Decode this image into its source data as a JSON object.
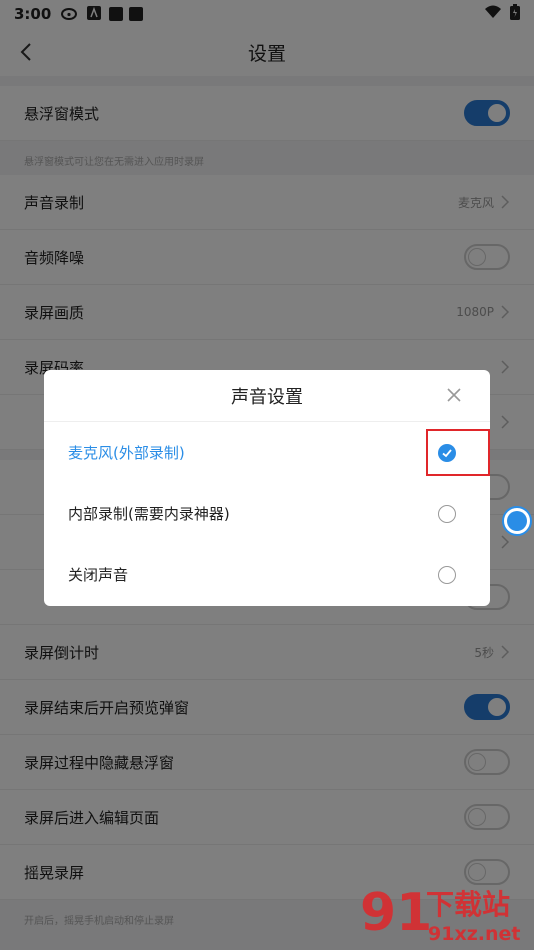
{
  "statusbar": {
    "time": "3:00"
  },
  "header": {
    "title": "设置"
  },
  "settings": {
    "float_mode": "悬浮窗模式",
    "float_hint": "悬浮窗模式可让您在无需进入应用时录屏",
    "audio_record": "声音录制",
    "audio_record_value": "麦克风",
    "noise_reduction": "音频降噪",
    "quality": "录屏画质",
    "quality_value": "1080P",
    "bitrate": "录屏码率",
    "countdown": "录屏倒计时",
    "countdown_value": "5秒",
    "preview_popup": "录屏结束后开启预览弹窗",
    "hide_float": "录屏过程中隐藏悬浮窗",
    "enter_edit": "录屏后进入编辑页面",
    "shake": "摇晃录屏",
    "shake_hint": "开启后，摇晃手机启动和停止录屏"
  },
  "dialog": {
    "title": "声音设置",
    "options": [
      "麦克风(外部录制)",
      "内部录制(需要内录神器)",
      "关闭声音"
    ],
    "selected_index": 0
  },
  "watermark": {
    "text": "下载站",
    "url": "91xz.net"
  },
  "colors": {
    "accent": "#2a8de6",
    "highlight": "#e0262a"
  }
}
